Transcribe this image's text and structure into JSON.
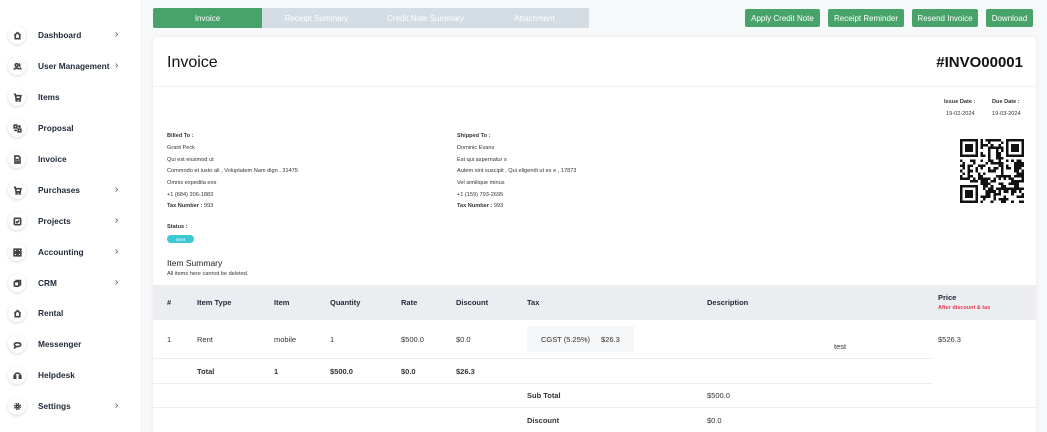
{
  "sidebar": {
    "items": [
      {
        "label": "Dashboard",
        "icon": "home-icon",
        "chevron": true
      },
      {
        "label": "User Management",
        "icon": "users-icon",
        "chevron": true
      },
      {
        "label": "Items",
        "icon": "cart-icon",
        "chevron": false
      },
      {
        "label": "Proposal",
        "icon": "proposal-icon",
        "chevron": false
      },
      {
        "label": "Invoice",
        "icon": "document-icon",
        "chevron": false
      },
      {
        "label": "Purchases",
        "icon": "cart-icon",
        "chevron": true
      },
      {
        "label": "Projects",
        "icon": "checkbox-icon",
        "chevron": true
      },
      {
        "label": "Accounting",
        "icon": "grid-icon",
        "chevron": true
      },
      {
        "label": "CRM",
        "icon": "layers-icon",
        "chevron": true
      },
      {
        "label": "Rental",
        "icon": "home-icon",
        "chevron": false
      },
      {
        "label": "Messenger",
        "icon": "chat-icon",
        "chevron": false
      },
      {
        "label": "Helpdesk",
        "icon": "headset-icon",
        "chevron": false
      },
      {
        "label": "Settings",
        "icon": "gear-icon",
        "chevron": true
      }
    ],
    "chevron_glyph": "›"
  },
  "tabs": [
    {
      "label": "Invoice",
      "active": true
    },
    {
      "label": "Receipt Summary",
      "active": false
    },
    {
      "label": "Credit Note Summary",
      "active": false
    },
    {
      "label": "Attachment",
      "active": false
    }
  ],
  "actions": {
    "apply_credit_note": "Apply Credit Note",
    "receipt_reminder": "Receipt Reminder",
    "resend_invoice": "Resend Invoice",
    "download": "Download"
  },
  "invoice": {
    "title": "Invoice",
    "number": "#INVO00001",
    "issue_date_label": "Issue Date :",
    "issue_date": "19-02-2024",
    "due_date_label": "Due Date :",
    "due_date": "19-03-2024",
    "billed_to": {
      "heading": "Billed To :",
      "name": "Grant Peck",
      "line1": "Qui est eiusmod ut",
      "line2": "Commodo et iusto ali , Voluptatem Nam dign , 31475",
      "line3": "Omnis expedita eos",
      "phone": "+1 (684) 206-1883",
      "tax_label": "Tax Number :",
      "tax_value": "993"
    },
    "shipped_to": {
      "heading": "Shipped To :",
      "name": "Dominic Evans",
      "line1": "Est qui aspernatur s",
      "line2": "Autem sint suscipit , Qui eligendi ut ex e , 17873",
      "line3": "Vel similique minus",
      "phone": "+1 (159) 793-2695",
      "tax_label": "Tax Number :",
      "tax_value": "993"
    },
    "status_label": "Status :",
    "status_value": "Sent",
    "summary_title": "Item Summary",
    "summary_note": "All items here cannot be deleted."
  },
  "table": {
    "headers": {
      "num": "#",
      "item_type": "Item Type",
      "item": "Item",
      "quantity": "Quantity",
      "rate": "Rate",
      "discount": "Discount",
      "tax": "Tax",
      "description": "Description",
      "price": "Price",
      "price_note": "After discount & tax"
    },
    "row": {
      "num": "1",
      "item_type": "Rent",
      "item": "mobile",
      "quantity": "1",
      "rate": "$500.0",
      "discount": "$0.0",
      "tax_name": "CGST (5.25%)",
      "tax_amount": "$26.3",
      "description": "test",
      "price": "$526.3"
    },
    "total": {
      "label": "Total",
      "item": "1",
      "quantity": "$500.0",
      "rate": "$0.0",
      "discount": "$26.3"
    },
    "sub_total_label": "Sub Total",
    "sub_total_value": "$500.0",
    "discount_label": "Discount",
    "discount_value": "$0.0"
  },
  "colors": {
    "accent": "#48a36a",
    "tab_inactive": "#d4dde4",
    "status_badge": "#3cc8d4",
    "price_note": "#e8384f"
  }
}
